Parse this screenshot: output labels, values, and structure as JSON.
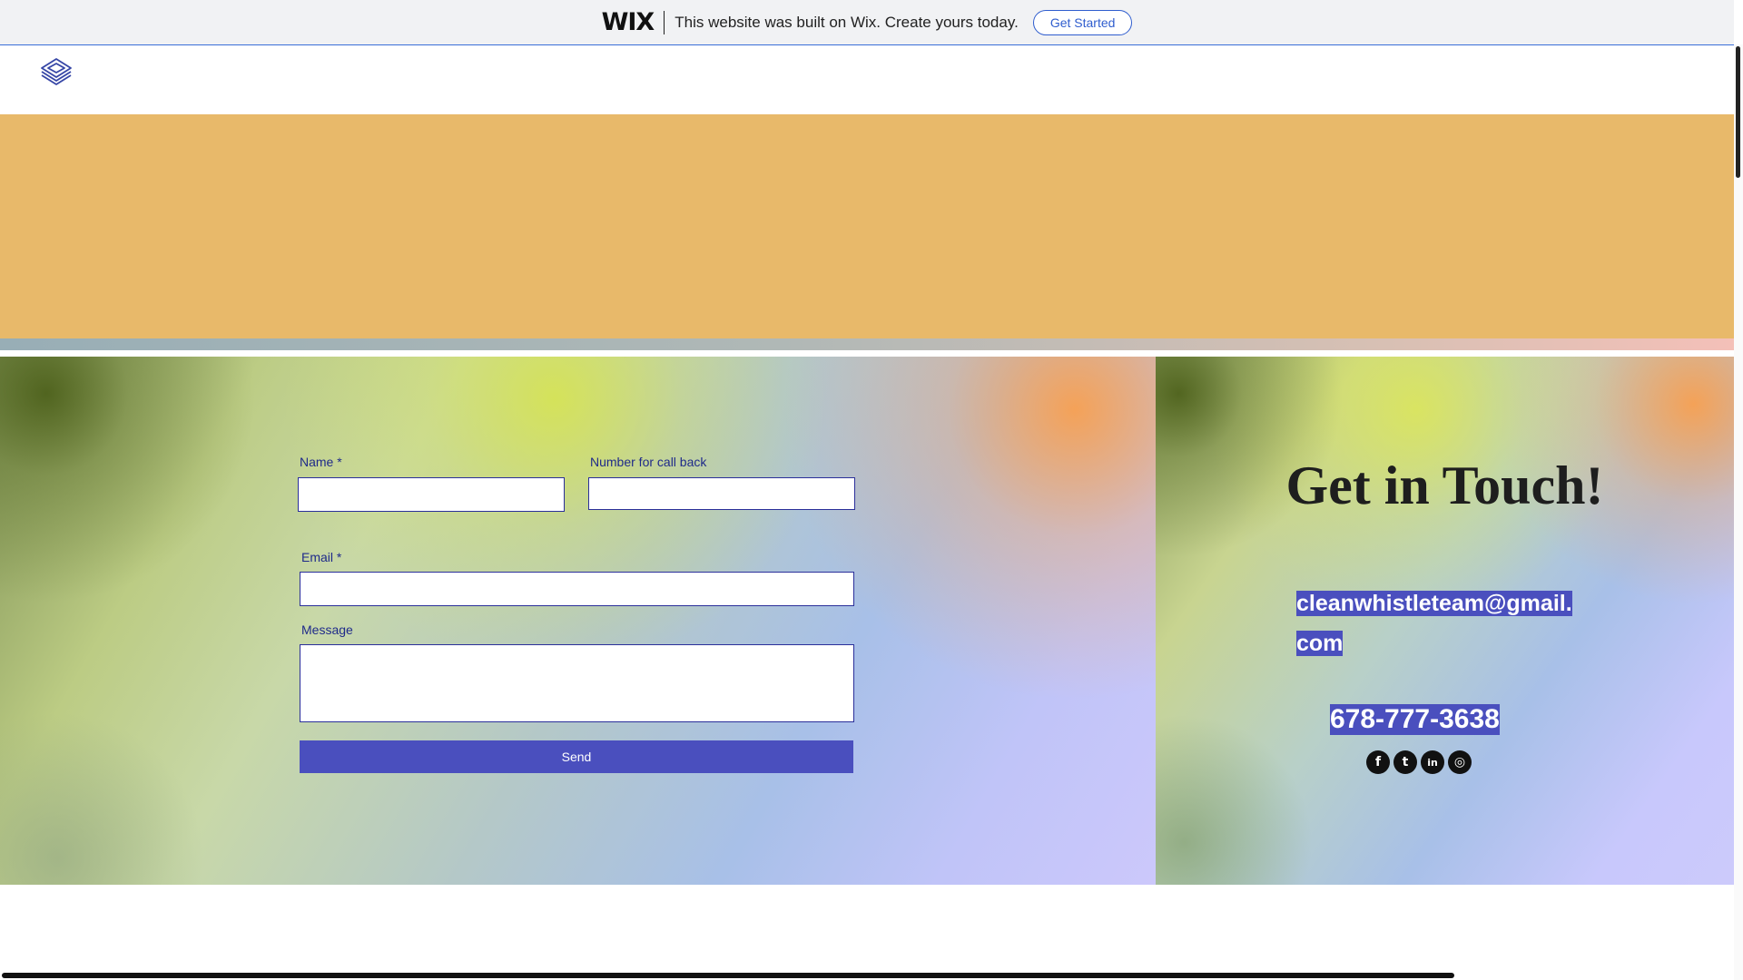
{
  "wix_banner": {
    "logo": "WIX",
    "message": "This website was built on Wix. Create yours today.",
    "cta_label": "Get Started"
  },
  "header": {
    "logo_icon": "layered-diamond-logo-icon"
  },
  "contact_form": {
    "name_label": "Name *",
    "name_value": "",
    "callback_label": "Number for call back",
    "callback_value": "",
    "email_label": "Email *",
    "email_value": "",
    "message_label": "Message",
    "message_value": "",
    "send_label": "Send"
  },
  "contact_info": {
    "title": "Get in Touch!",
    "email": "cleanwhistleteam@gmail.com",
    "phone": "678-777-3638",
    "social_icons": [
      {
        "icon": "facebook-icon",
        "glyph": "f"
      },
      {
        "icon": "twitter-icon",
        "glyph": "t"
      },
      {
        "icon": "linkedin-icon",
        "glyph": "in"
      },
      {
        "icon": "instagram-icon",
        "glyph": "◎"
      }
    ]
  },
  "colors": {
    "accent": "#4a4fbe",
    "hero_band": "#e8b96a",
    "label_text": "#1f2a8a",
    "banner_link": "#2f5dce"
  }
}
